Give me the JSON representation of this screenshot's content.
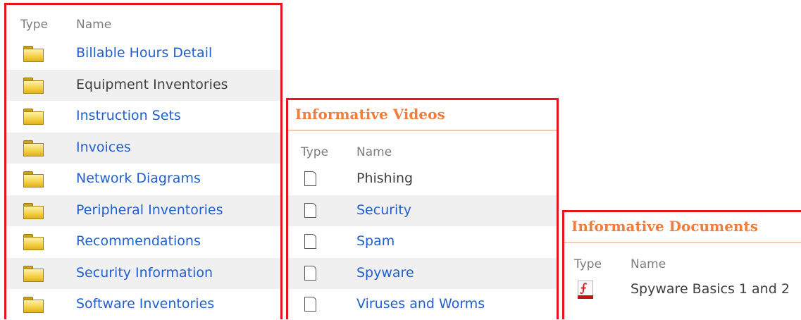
{
  "colors": {
    "panel_border": "#e8141c",
    "section_title": "#f07d3c",
    "link": "#1f5fd0",
    "text": "#404040",
    "header_text": "#7d7d7d",
    "alt_row": "#f0f0f0"
  },
  "folders_panel": {
    "columns": {
      "type": "Type",
      "name": "Name"
    },
    "rows": [
      {
        "name": "Billable Hours Detail",
        "icon": "folder-icon",
        "link": true
      },
      {
        "name": "Equipment Inventories",
        "icon": "folder-icon",
        "link": false
      },
      {
        "name": "Instruction Sets",
        "icon": "folder-icon",
        "link": true
      },
      {
        "name": "Invoices",
        "icon": "folder-icon",
        "link": true
      },
      {
        "name": "Network Diagrams",
        "icon": "folder-icon",
        "link": true
      },
      {
        "name": "Peripheral Inventories",
        "icon": "folder-icon",
        "link": true
      },
      {
        "name": "Recommendations",
        "icon": "folder-icon",
        "link": true
      },
      {
        "name": "Security Information",
        "icon": "folder-icon",
        "link": true
      },
      {
        "name": "Software Inventories",
        "icon": "folder-icon",
        "link": true
      }
    ]
  },
  "videos_panel": {
    "title": "Informative Videos",
    "columns": {
      "type": "Type",
      "name": "Name"
    },
    "rows": [
      {
        "name": "Phishing",
        "icon": "document-icon",
        "link": false
      },
      {
        "name": "Security",
        "icon": "document-icon",
        "link": true
      },
      {
        "name": "Spam",
        "icon": "document-icon",
        "link": true
      },
      {
        "name": "Spyware",
        "icon": "document-icon",
        "link": true
      },
      {
        "name": "Viruses and Worms",
        "icon": "document-icon",
        "link": true
      }
    ]
  },
  "documents_panel": {
    "title": "Informative Documents",
    "columns": {
      "type": "Type",
      "name": "Name"
    },
    "rows": [
      {
        "name": "Spyware Basics 1 and 2",
        "icon": "pdf-icon",
        "link": false
      }
    ]
  }
}
